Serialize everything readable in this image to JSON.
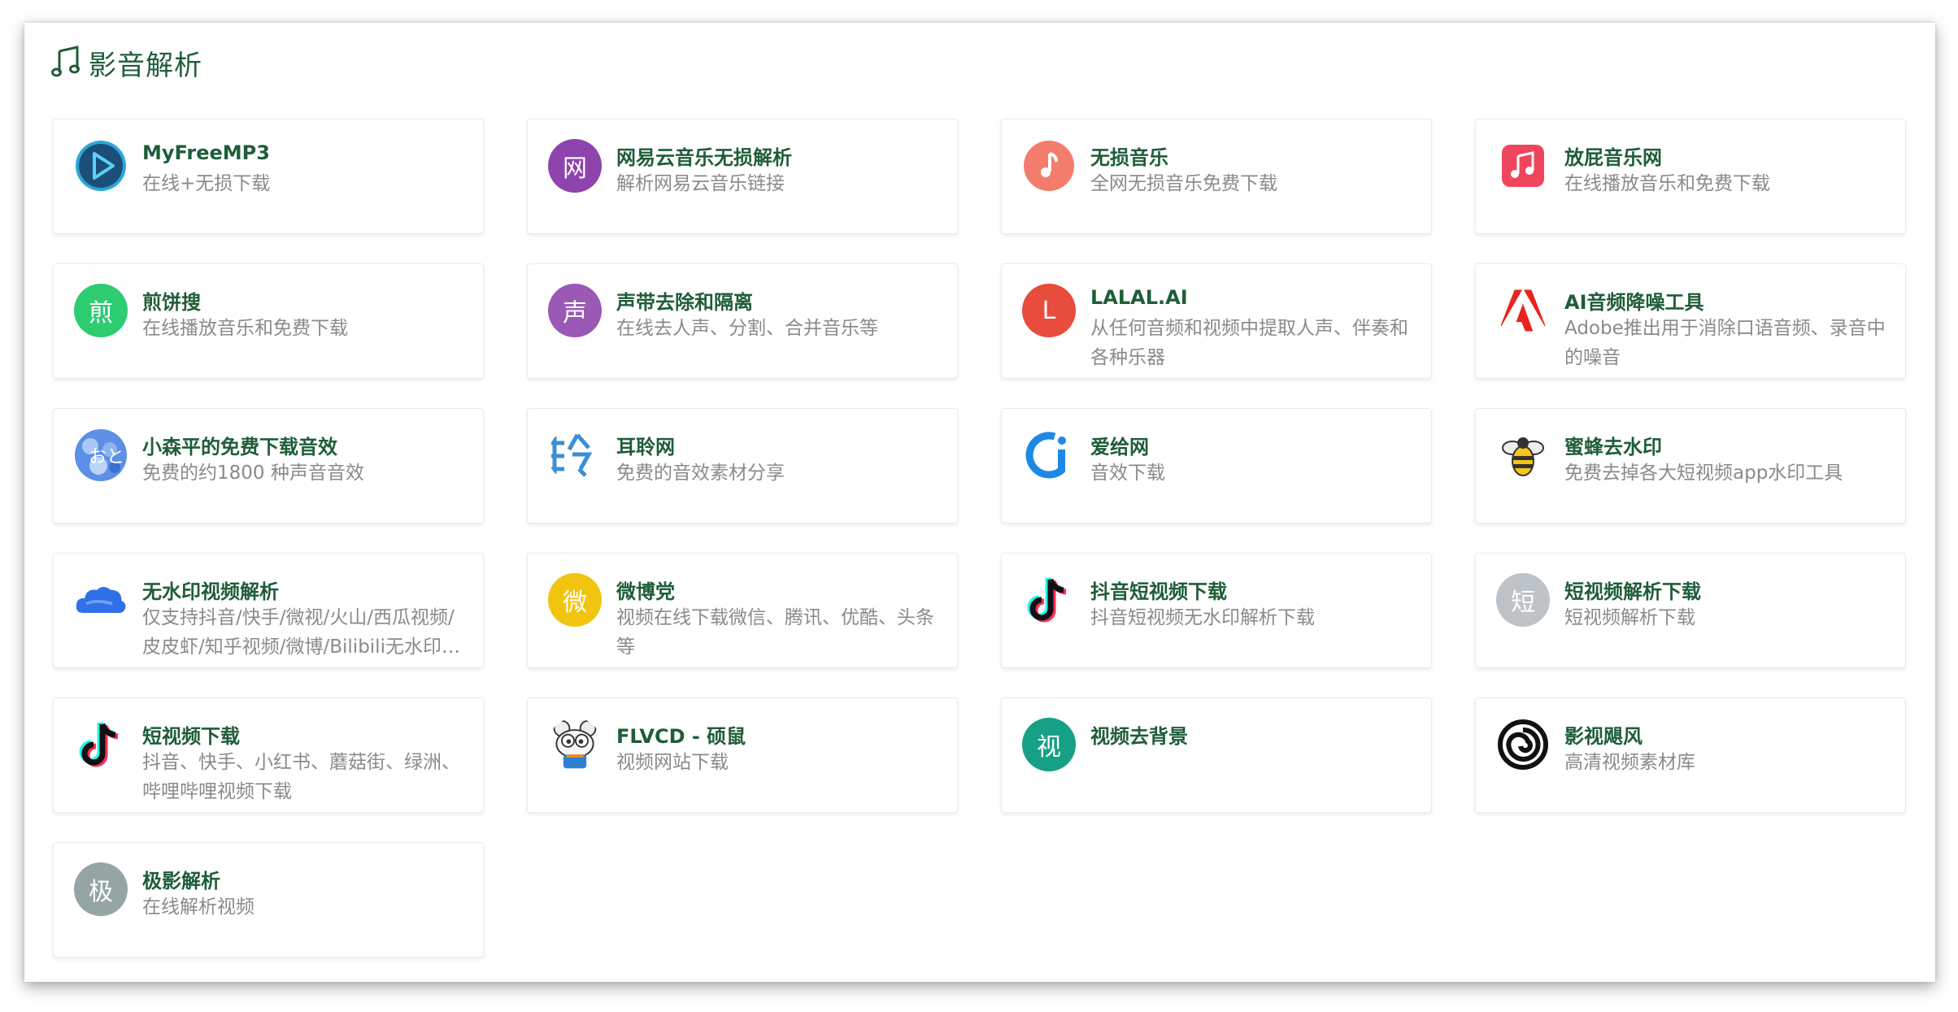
{
  "section": {
    "title": "影音解析",
    "icon": "music-note-icon"
  },
  "cards": [
    {
      "name": "MyFreeMP3",
      "desc": "在线+无损下载",
      "icon": "play-circle-logo",
      "color": "#1b4f7a"
    },
    {
      "name": "网易云音乐无损解析",
      "desc": "解析网易云音乐链接",
      "icon": "text-logo",
      "glyph": "网",
      "color": "#8e44ad"
    },
    {
      "name": "无损音乐",
      "desc": "全网无损音乐免费下载",
      "icon": "music-note-logo",
      "color": "#f47c6d"
    },
    {
      "name": "放屁音乐网",
      "desc": "在线播放音乐和免费下载",
      "icon": "music-square-logo",
      "color": "#f0465d"
    },
    {
      "name": "煎饼搜",
      "desc": "在线播放音乐和免费下载",
      "icon": "text-logo",
      "glyph": "煎",
      "color": "#2ecc71"
    },
    {
      "name": "声带去除和隔离",
      "desc": "在线去人声、分割、合并音乐等",
      "icon": "text-logo",
      "glyph": "声",
      "color": "#9b59b6"
    },
    {
      "name": "LALAL.AI",
      "desc": "从任何音频和视频中提取人声、伴奏和各种乐器",
      "icon": "text-logo",
      "glyph": "L",
      "color": "#e74c3c"
    },
    {
      "name": "AI音频降噪工具",
      "desc": "Adobe推出用于消除口语音频、录音中的噪音",
      "icon": "adobe-logo",
      "color": "#e8231d"
    },
    {
      "name": "小森平的免费下载音效",
      "desc": "免费的约1800 种声音音效",
      "icon": "blue-pattern-logo",
      "color": "#4a7fe0"
    },
    {
      "name": "耳聆网",
      "desc": "免费的音效素材分享",
      "icon": "erling-logo",
      "color": "#3b8fd6"
    },
    {
      "name": "爱给网",
      "desc": "音效下载",
      "icon": "aigei-logo",
      "color": "#1e88e5"
    },
    {
      "name": "蜜蜂去水印",
      "desc": "免费去掉各大短视频app水印工具",
      "icon": "bee-logo",
      "color": "#f5c518"
    },
    {
      "name": "无水印视频解析",
      "desc": "仅支持抖音/快手/微视/火山/西瓜视频/皮皮虾/知乎视频/微博/Bilibili无水印视频解析",
      "icon": "cloud-logo",
      "color": "#2f6fe8"
    },
    {
      "name": "微博党",
      "desc": "视频在线下载微信、腾讯、优酷、头条等",
      "icon": "text-logo",
      "glyph": "微",
      "color": "#f1c40f"
    },
    {
      "name": "抖音短视频下载",
      "desc": "抖音短视频无水印解析下载",
      "icon": "tiktok-logo",
      "color": "#000000"
    },
    {
      "name": "短视频解析下载",
      "desc": "短视频解析下载",
      "icon": "text-logo",
      "glyph": "短",
      "color": "#bdc3c7"
    },
    {
      "name": "短视频下载",
      "desc": "抖音、快手、小红书、蘑菇街、绿洲、哔哩哔哩视频下载",
      "icon": "tiktok-logo",
      "color": "#000000"
    },
    {
      "name": "FLVCD - 硕鼠",
      "desc": "视频网站下载",
      "icon": "mouse-logo",
      "color": "#f08b1c"
    },
    {
      "name": "视频去背景",
      "desc": "",
      "icon": "text-logo",
      "glyph": "视",
      "color": "#16a085"
    },
    {
      "name": "影视飓风",
      "desc": "高清视频素材库",
      "icon": "spiral-logo",
      "color": "#000000"
    },
    {
      "name": "极影解析",
      "desc": "在线解析视频",
      "icon": "text-logo",
      "glyph": "极",
      "color": "#95a5a6"
    }
  ]
}
